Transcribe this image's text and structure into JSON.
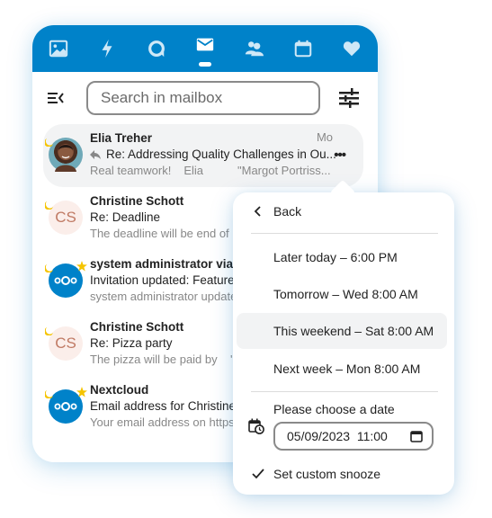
{
  "colors": {
    "brand": "#0082c9",
    "hover_bg": "#f2f3f4",
    "badge_yellow": "#f5c400"
  },
  "topbar": {
    "apps": [
      {
        "name": "photos",
        "icon": "image-icon",
        "active": false
      },
      {
        "name": "activity",
        "icon": "lightning-icon",
        "active": false
      },
      {
        "name": "talk",
        "icon": "talk-icon",
        "active": false
      },
      {
        "name": "mail",
        "icon": "mail-icon",
        "active": true
      },
      {
        "name": "contacts",
        "icon": "contacts-icon",
        "active": false
      },
      {
        "name": "calendar",
        "icon": "calendar-icon",
        "active": false
      },
      {
        "name": "favorites",
        "icon": "heart-icon",
        "active": false
      }
    ]
  },
  "search": {
    "placeholder": "Search in mailbox",
    "value": ""
  },
  "mails": [
    {
      "sender": "Elia Treher",
      "subject": "Re: Addressing Quality Challenges in Ou...",
      "preview_parts": [
        "Real teamwork!",
        "Elia",
        "\"Margot Portriss..."
      ],
      "date": "Mo",
      "replied": true,
      "avatar": "photo",
      "active": true
    },
    {
      "sender": "Christine Schott",
      "subject": "Re: Deadline",
      "preview": "The deadline will be end of b",
      "avatar": "initials",
      "initials": "CS"
    },
    {
      "sender": "system administrator via N",
      "subject": "Invitation updated: Feature d",
      "preview": "system administrator update",
      "avatar": "nextcloud",
      "starred": true
    },
    {
      "sender": "Christine Schott",
      "subject": "Re: Pizza party",
      "preview": "The pizza will be paid by    \"",
      "avatar": "initials",
      "initials": "CS"
    },
    {
      "sender": "Nextcloud",
      "subject": "Email address for Christine S",
      "preview": "Your email address on https:",
      "avatar": "nextcloud",
      "starred": true
    }
  ],
  "snooze_menu": {
    "back_label": "Back",
    "options": [
      "Later today – 6:00 PM",
      "Tomorrow – Wed 8:00 AM",
      "This weekend – Sat 8:00 AM",
      "Next week – Mon 8:00 AM"
    ],
    "hovered_option": "This weekend – Sat 8:00 AM",
    "date_label": "Please choose a date",
    "date_value": "05/09/2023  11:00",
    "confirm_label": "Set custom snooze"
  }
}
